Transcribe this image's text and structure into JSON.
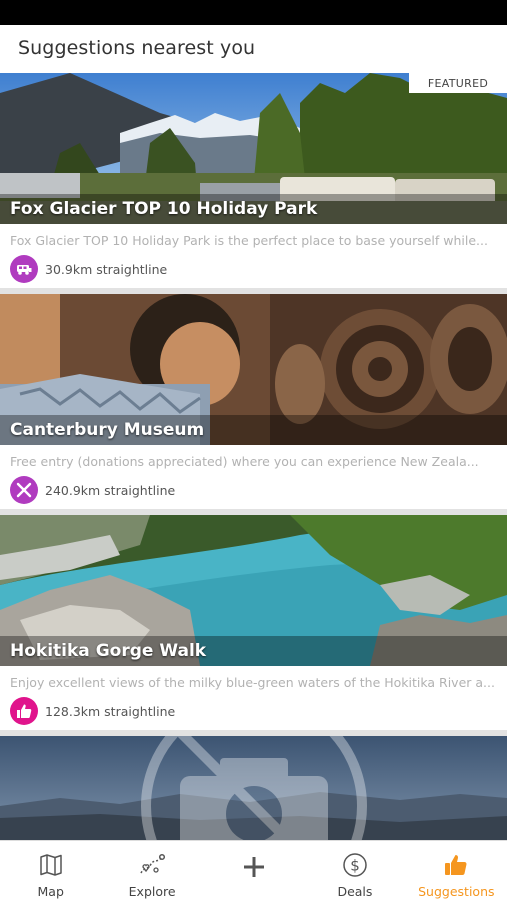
{
  "header": {
    "title": "Suggestions nearest you"
  },
  "cards": [
    {
      "title": "Fox Glacier TOP 10 Holiday Park",
      "badge": "FEATURED",
      "description": "Fox Glacier TOP 10 Holiday Park is the perfect place to base yourself while...",
      "distance": "30.9km straightline",
      "category_icon": "camper-van-icon",
      "category_color": "#b03bbf"
    },
    {
      "title": "Canterbury Museum",
      "description": "Free entry (donations appreciated) where you can experience New Zeala...",
      "distance": "240.9km straightline",
      "category_icon": "attraction-icon",
      "category_color": "#b03bbf"
    },
    {
      "title": "Hokitika Gorge Walk",
      "description": "Enjoy excellent views of the milky blue-green waters of the Hokitika River a...",
      "distance": "128.3km straightline",
      "category_icon": "thumbs-up-icon",
      "category_color": "#e0148c"
    },
    {
      "image_icon": "no-photo-icon"
    }
  ],
  "tabbar": {
    "items": [
      {
        "label": "Map",
        "icon": "map-icon"
      },
      {
        "label": "Explore",
        "icon": "explore-icon"
      },
      {
        "label": "",
        "icon": "plus-icon"
      },
      {
        "label": "Deals",
        "icon": "dollar-icon"
      },
      {
        "label": "Suggestions",
        "icon": "thumbs-up-icon",
        "active": true
      }
    ],
    "active_color": "#f5961f"
  }
}
